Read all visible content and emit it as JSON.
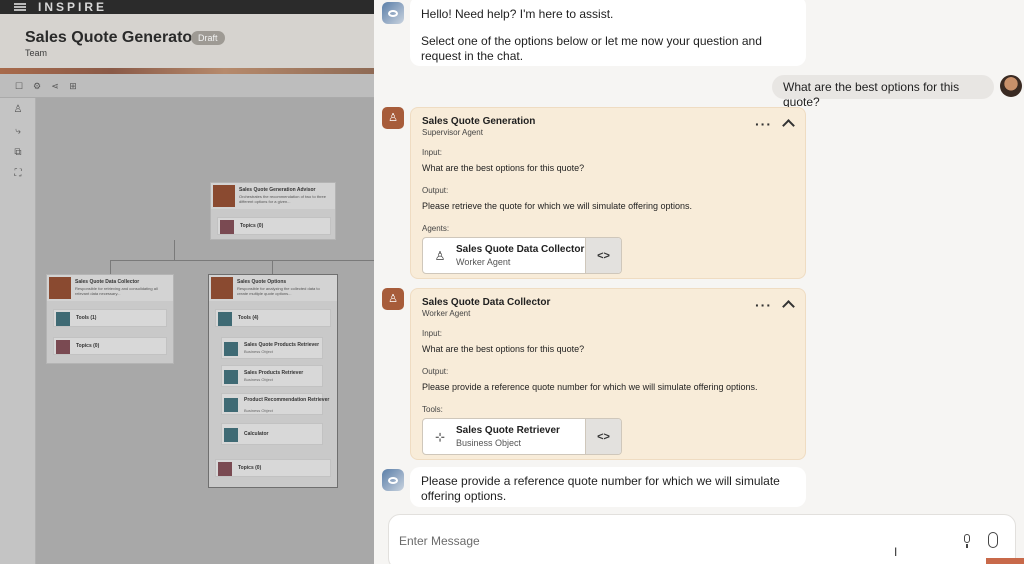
{
  "left_app": {
    "brand": "INSPIRE",
    "page_title": "Sales Quote Generator",
    "badge": "Draft",
    "subtitle": "Team",
    "nodes": {
      "advisor": {
        "title": "Sales Quote Generation Advisor",
        "desc": "Orchestrates the recommendation of two to three different options for a given...",
        "topics": "Topics (0)"
      },
      "collector": {
        "title": "Sales Quote Data Collector",
        "desc": "Responsible for retrieving and consolidating all relevant data necessary...",
        "tools": "Tools (1)",
        "topics": "Topics (0)"
      },
      "options": {
        "title": "Sales Quote Options",
        "desc": "Responsible for analyzing the collected data to create multiple quote options...",
        "tools": "Tools (4)",
        "items": [
          {
            "label": "Sales Quote Products Retriever",
            "sub": "Business Object"
          },
          {
            "label": "Sales Products Retriever",
            "sub": "Business Object"
          },
          {
            "label": "Product Recommendation Retriever",
            "sub": "Business Object"
          },
          {
            "label": "Calculator",
            "sub": ""
          }
        ],
        "topics": "Topics (0)"
      }
    }
  },
  "chat": {
    "greeting": {
      "line1": "Hello! Need help? I'm here to assist.",
      "line2": "Select one of the options below or let me now your question and request in the chat."
    },
    "user_message": "What are the best options for this quote?",
    "cards": [
      {
        "title": "Sales Quote Generation",
        "subtitle": "Supervisor Agent",
        "input_label": "Input:",
        "input_value": "What are the best options for this quote?",
        "output_label": "Output:",
        "output_value": "Please retrieve the quote for which we will simulate offering options.",
        "list_label": "Agents:",
        "item": {
          "title": "Sales Quote Data Collector",
          "subtitle": "Worker Agent",
          "icon": "agent-icon"
        }
      },
      {
        "title": "Sales Quote Data Collector",
        "subtitle": "Worker Agent",
        "input_label": "Input:",
        "input_value": "What are the best options for this quote?",
        "output_label": "Output:",
        "output_value": "Please provide a reference quote number for which we will simulate offering options.",
        "list_label": "Tools:",
        "item": {
          "title": "Sales Quote Retriever",
          "subtitle": "Business Object",
          "icon": "business-object-icon"
        }
      }
    ],
    "final_message": "Please provide a reference quote number for which we will simulate offering options.",
    "input": {
      "placeholder": "Enter Message"
    },
    "colors": {
      "agent_card_bg": "#f8ecd9",
      "agent_icon": "#a75c3a",
      "send_accent": "#c8694a"
    }
  }
}
